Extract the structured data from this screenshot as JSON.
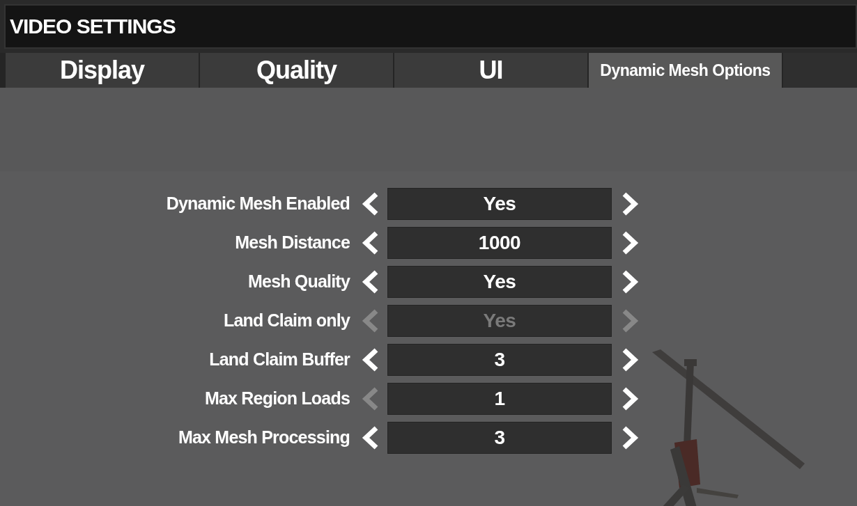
{
  "window": {
    "title": "VIDEO SETTINGS"
  },
  "tabs": [
    {
      "label": "Display",
      "selected": false
    },
    {
      "label": "Quality",
      "selected": false
    },
    {
      "label": "UI",
      "selected": false
    },
    {
      "label": "Dynamic Mesh Options",
      "selected": true
    }
  ],
  "settings": [
    {
      "label": "Dynamic Mesh Enabled",
      "value": "Yes",
      "disabled": false,
      "prev_disabled": false,
      "next_disabled": false
    },
    {
      "label": "Mesh Distance",
      "value": "1000",
      "disabled": false,
      "prev_disabled": false,
      "next_disabled": false
    },
    {
      "label": "Mesh Quality",
      "value": "Yes",
      "disabled": false,
      "prev_disabled": false,
      "next_disabled": false
    },
    {
      "label": "Land Claim only",
      "value": "Yes",
      "disabled": true,
      "prev_disabled": true,
      "next_disabled": true
    },
    {
      "label": "Land Claim Buffer",
      "value": "3",
      "disabled": false,
      "prev_disabled": false,
      "next_disabled": false
    },
    {
      "label": "Max Region Loads",
      "value": "1",
      "disabled": false,
      "prev_disabled": true,
      "next_disabled": false
    },
    {
      "label": "Max Mesh Processing",
      "value": "3",
      "disabled": false,
      "prev_disabled": false,
      "next_disabled": false
    }
  ]
}
